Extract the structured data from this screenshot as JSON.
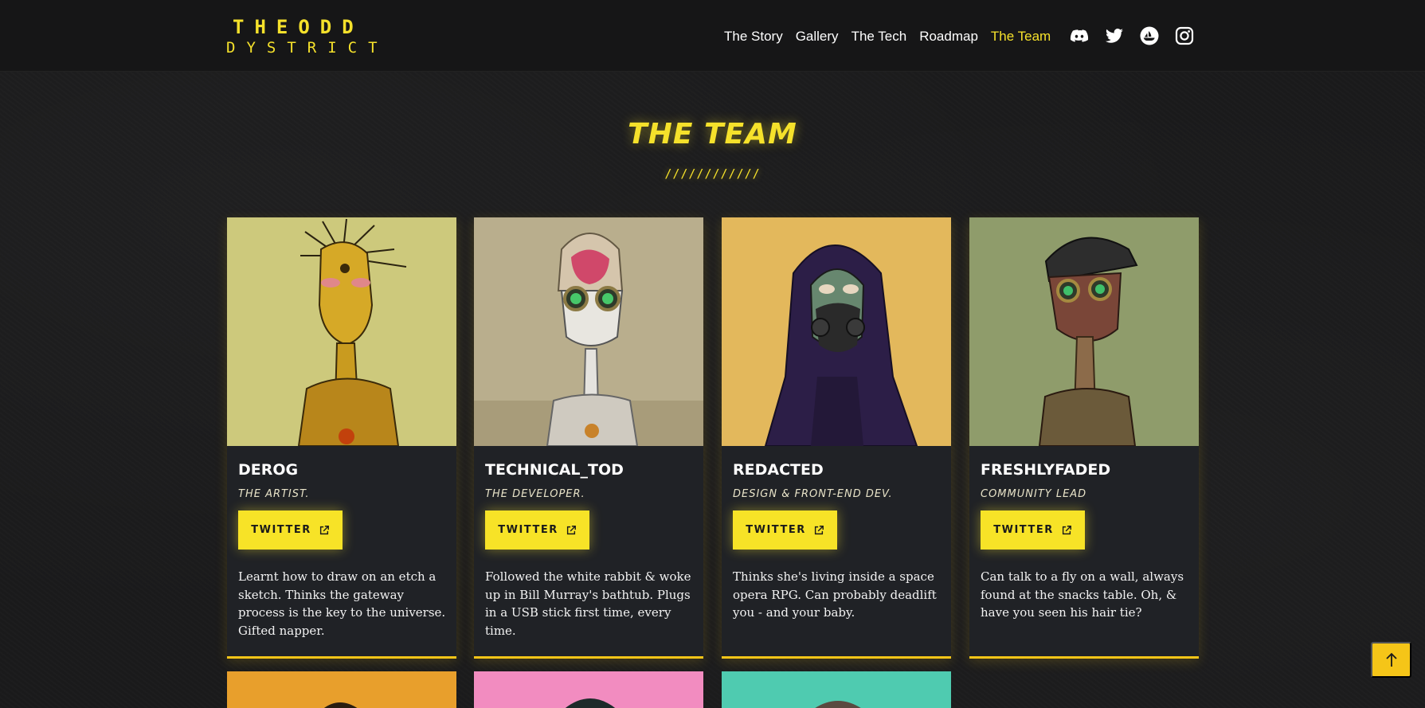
{
  "brand": {
    "line1": "THEODD",
    "line2": "DYSTRICT",
    "color": "#f5e12b"
  },
  "nav": {
    "items": [
      {
        "label": "The Story",
        "active": false
      },
      {
        "label": "Gallery",
        "active": false
      },
      {
        "label": "The Tech",
        "active": false
      },
      {
        "label": "Roadmap",
        "active": false
      },
      {
        "label": "The Team",
        "active": true
      }
    ],
    "socials": [
      "discord-icon",
      "twitter-icon",
      "opensea-icon",
      "instagram-icon"
    ]
  },
  "section": {
    "title": "THE TEAM",
    "divider": "////////////"
  },
  "team": [
    {
      "name": "DEROG",
      "role": "THE ARTIST.",
      "button": "TWITTER",
      "bio": "Learnt how to draw on an etch a sketch. Thinks the gateway process is the key to the universe. Gifted napper.",
      "bg": "#cdc97c"
    },
    {
      "name": "TECHNICAL_TOD",
      "role": "THE DEVELOPER.",
      "button": "TWITTER",
      "bio": "Followed the white rabbit & woke up in Bill Murray's bathtub. Plugs in a USB stick first time, every time.",
      "bg": "#b9ae8d"
    },
    {
      "name": "REDACTED",
      "role": "DESIGN & FRONT-END DEV.",
      "button": "TWITTER",
      "bio": "Thinks she's living inside a space opera RPG. Can probably deadlift you - and your baby.",
      "bg": "#e3b85c"
    },
    {
      "name": "FRESHLYFADED",
      "role": "COMMUNITY LEAD",
      "button": "TWITTER",
      "bio": "Can talk to a fly on a wall, always found at the snacks table. Oh, & have you seen his hair tie?",
      "bg": "#8f9c6b"
    }
  ],
  "next_row_colors": [
    "#e89f2c",
    "#f28cc0",
    "#4fcbb0"
  ],
  "colors": {
    "accent": "#f5e12b",
    "card": "#202226",
    "background": "#1a1a1b"
  }
}
